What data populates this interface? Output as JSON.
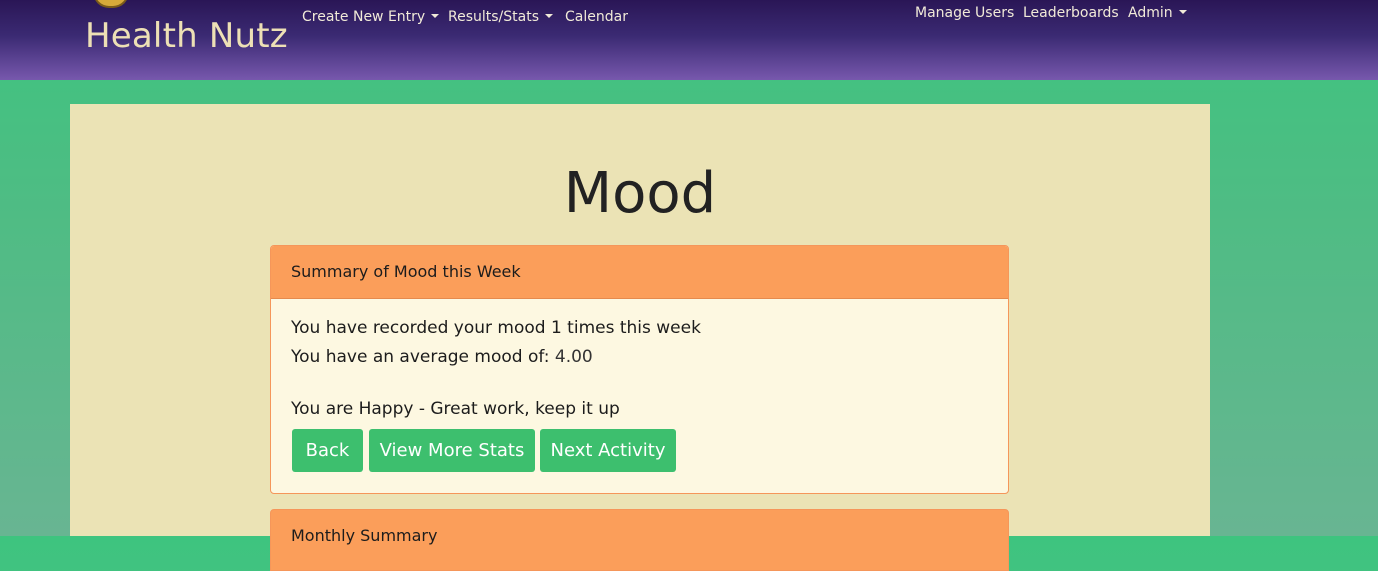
{
  "nav": {
    "brand": "Health Nutz",
    "left_items": [
      {
        "label": "Create New Entry",
        "dropdown": true
      },
      {
        "label": "Results/Stats",
        "dropdown": true
      },
      {
        "label": "Calendar",
        "dropdown": false
      }
    ],
    "right_items": [
      {
        "label": "Manage Users",
        "dropdown": false
      },
      {
        "label": "Leaderboards",
        "dropdown": false
      },
      {
        "label": "Admin",
        "dropdown": true
      }
    ]
  },
  "page": {
    "title": "Mood"
  },
  "weekly_card": {
    "header": "Summary of Mood this Week",
    "recorded_text": "You have recorded your mood 1 times this week",
    "average_label": "You have an average mood of:",
    "average_value": "4.00",
    "status_text": "You are Happy - Great work, keep it up",
    "buttons": {
      "back": "Back",
      "more_stats": "View More Stats",
      "next": "Next Activity"
    }
  },
  "monthly_card": {
    "header": "Monthly Summary"
  },
  "colors": {
    "nav_top": "#2a1656",
    "nav_bottom": "#7758ad",
    "page_bg": "#3ec47f",
    "container_bg": "#ebe3b5",
    "card_header": "#fb9e5a",
    "card_body": "#fdf8e1",
    "button": "#3dbf6e"
  },
  "icons": {
    "logo": "health-nutz-logo-icon",
    "dropdown": "caret-down-icon"
  }
}
